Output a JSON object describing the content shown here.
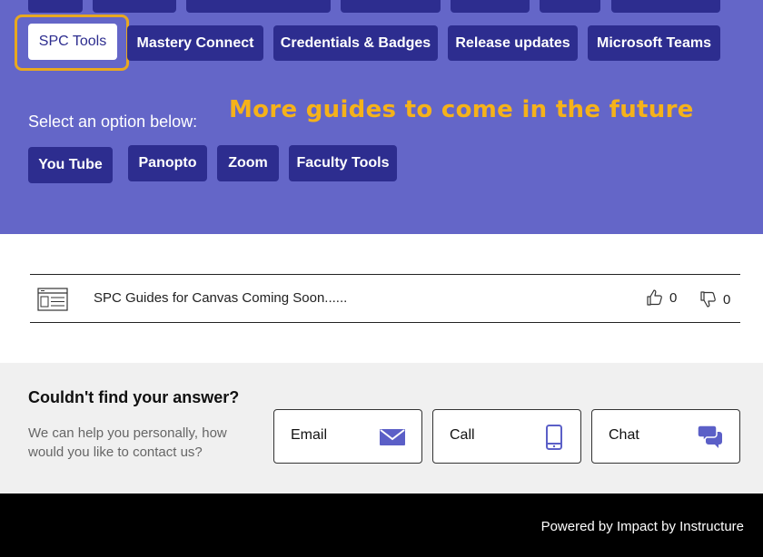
{
  "nav": {
    "top_row_buttons": [
      {
        "label": ""
      },
      {
        "label": ""
      },
      {
        "label": ""
      },
      {
        "label": ""
      },
      {
        "label": ""
      },
      {
        "label": ""
      },
      {
        "label": ""
      }
    ],
    "second_row_buttons": [
      {
        "label": "SPC Tools",
        "active": true
      },
      {
        "label": "Mastery Connect"
      },
      {
        "label": "Credentials & Badges"
      },
      {
        "label": "Release updates"
      },
      {
        "label": "Microsoft Teams"
      }
    ]
  },
  "options": {
    "label": "Select an option below:",
    "note": "More guides to come in the future",
    "buttons": [
      "You Tube",
      "Panopto",
      "Zoom",
      "Faculty Tools"
    ]
  },
  "article": {
    "icon": "document-list-icon",
    "title": "SPC Guides for Canvas Coming Soon......",
    "likes": "0",
    "dislikes": "0"
  },
  "contact": {
    "title": "Couldn't find your answer?",
    "subtitle": "We can help you personally, how would you like to contact us?",
    "buttons": [
      {
        "label": "Email",
        "icon": "envelope-icon"
      },
      {
        "label": "Call",
        "icon": "phone-icon"
      },
      {
        "label": "Chat",
        "icon": "chat-bubbles-icon"
      }
    ]
  },
  "footer": {
    "text": "Powered by Impact by Instructure"
  },
  "colors": {
    "hero_bg": "#6466c8",
    "button_bg": "#2d2d8f",
    "focus_ring": "#e8a820",
    "note_text": "#f5b21a",
    "icon_accent": "#5b5fc7"
  }
}
